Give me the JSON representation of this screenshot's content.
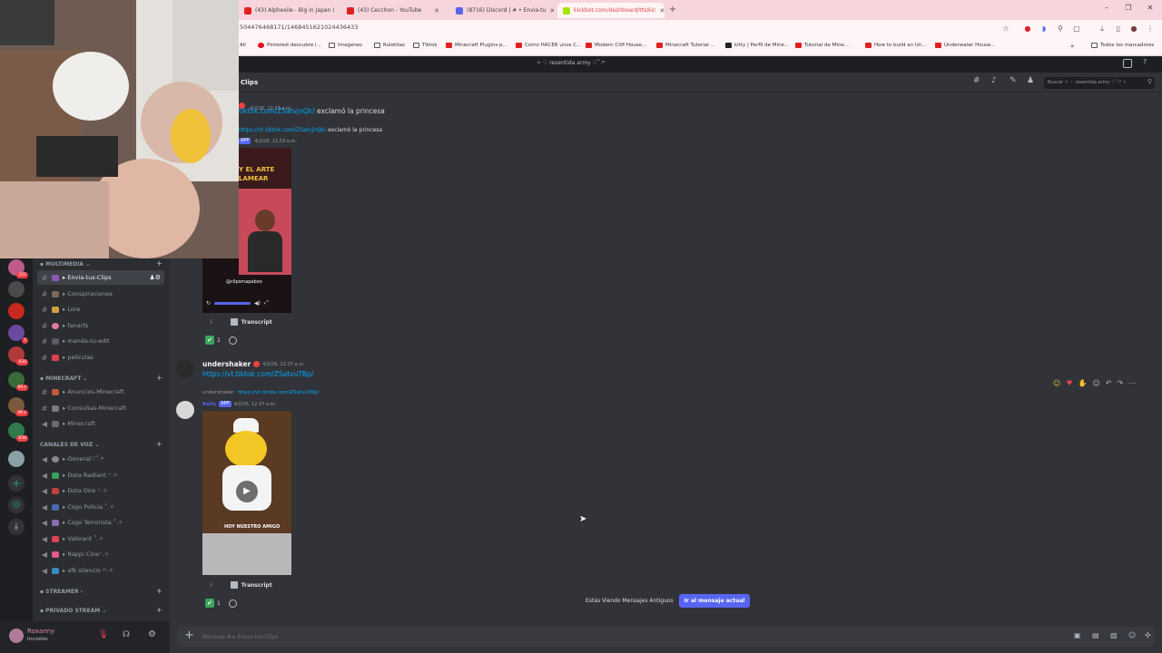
{
  "browser": {
    "tabs": [
      {
        "title": "(43) Alphexile - Big in Japan ("
      },
      {
        "title": "(43) Cecchon - YouTube"
      },
      {
        "title": "(8716) Discord | # • Envia-tu"
      },
      {
        "title": "kickbot.com/dashboard/tts/kic"
      }
    ],
    "url": "504476468171/1468451621024436433",
    "bookmarks": [
      "All",
      "Pinterest descubre i...",
      "Imagenes",
      "Ruletitas",
      "Tiktok",
      "Minecraft Plugins p...",
      "Como HACER unos C...",
      "Modern Cliff House...",
      "Minecraft Tutorial ...",
      "kitty | Perfil de Mine...",
      "Tutorial de Mine...",
      "How to build an Un...",
      "Underwater House..."
    ],
    "all_bookmarks_label": "Todos los marcadores",
    "more_label": "»"
  },
  "discord": {
    "app_title": "✧ ♡ resentida army ♡˚.*",
    "channel_name": "Clips",
    "search_placeholder": "Buscar ✧ ♡ resentida army ♡˚.* ✧",
    "server_badges": [
      "322",
      "1",
      "434",
      "99+",
      "4K+",
      "838"
    ],
    "categories": [
      {
        "name": "▪ MULTIMEDIA ⌄",
        "channels": [
          "▸ Envia-tus-Clips",
          "▸ Conspiraciones",
          "▸ Lore",
          "▸ fanarts",
          "▸ manda-tu-edit",
          "▸ peliculas"
        ]
      },
      {
        "name": "▪ MINECRAFT ⌄",
        "channels": [
          "▸ Anuncios-Minecraft",
          "▸ Consultas-Minecraft",
          "▸ Minecraft"
        ]
      },
      {
        "name": "CANALES DE VOZ ⌄",
        "channels": [
          "▸ General♡˚.*",
          "▸ Dota Radiant ⁺.✧",
          "▸ Dota Dire ⁺.✧",
          "▸ Csgo Policia ˚.✧",
          "▸ Csgo Terrorista ˚.✧",
          "▸ Valorant ˚.✧",
          "▸ Rappi Cine⁺.✧",
          "▸ afk silencio ᶻᶻ.✧"
        ]
      },
      {
        "name": "▪ STREAMER ›",
        "channels": []
      },
      {
        "name": "▪ PRIVADO STREAM ⌄",
        "channels": []
      }
    ],
    "user": {
      "name": "Roxanny",
      "status": "Invisible"
    },
    "messages": {
      "m1_time": "4/2/26, 12:33 a.m.",
      "m1_link": "tiktok.com/ZSatvjnQk/",
      "m1_text": "exclamó la princesa",
      "m1_reply_link": "https://vt.tiktok.com/ZSatvjnQk/",
      "m1_reply_text": "exclamó la princesa",
      "app_tag": "APP",
      "m1b_time": "4/2/26, 12:33 a.m.",
      "video1_caption1": "Y EL ARTE",
      "video1_caption2": "LAMEAR",
      "video1_watermark": "@clipsmapaboo",
      "transcript": "Transcript",
      "reaction_count": "1",
      "m2_user": "undershaker",
      "m2_time": "4/2/26, 12:37 a.m.",
      "m2_link": "https://vt.tiktok.com/ZSatvuTBp/",
      "m3_reply_user": "undershaker",
      "m3_reply_link": "https://vt.tiktok.com/ZSatvuTBp/",
      "m3_user": "Kelly",
      "m3_time": "4/2/26, 12:37 a.m.",
      "video2_caption": "HOY NUESTRO AMIGO"
    },
    "jump_notice": "Estás Viendo Mensajes Antiguos",
    "jump_button": "Ir al mensaje actual",
    "input_placeholder": "Mensaje # ▸ Envia-tus-Clips"
  }
}
